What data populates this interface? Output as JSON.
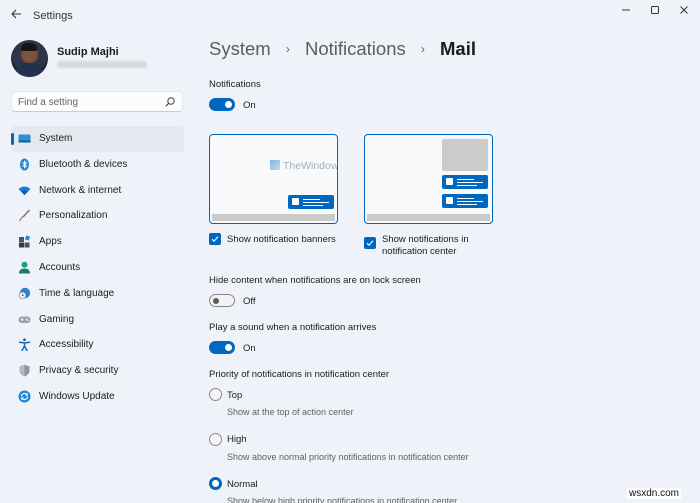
{
  "window": {
    "title": "Settings",
    "back_icon": "back-arrow-icon",
    "controls": {
      "minimize": "—",
      "maximize": "☐",
      "close": "✕"
    }
  },
  "profile": {
    "name": "Sudip Majhi",
    "email_blurred": true
  },
  "search": {
    "placeholder": "Find a setting",
    "value": "",
    "icon": "search-icon"
  },
  "sidebar": {
    "items": [
      {
        "label": "System",
        "icon": "system-icon",
        "active": true
      },
      {
        "label": "Bluetooth & devices",
        "icon": "bluetooth-icon",
        "active": false
      },
      {
        "label": "Network & internet",
        "icon": "wifi-icon",
        "active": false
      },
      {
        "label": "Personalization",
        "icon": "brush-icon",
        "active": false
      },
      {
        "label": "Apps",
        "icon": "apps-icon",
        "active": false
      },
      {
        "label": "Accounts",
        "icon": "person-icon",
        "active": false
      },
      {
        "label": "Time & language",
        "icon": "globe-clock-icon",
        "active": false
      },
      {
        "label": "Gaming",
        "icon": "gamepad-icon",
        "active": false
      },
      {
        "label": "Accessibility",
        "icon": "accessibility-icon",
        "active": false
      },
      {
        "label": "Privacy & security",
        "icon": "shield-icon",
        "active": false
      },
      {
        "label": "Windows Update",
        "icon": "update-icon",
        "active": false
      }
    ]
  },
  "breadcrumb": {
    "parts": [
      "System",
      "Notifications"
    ],
    "separator": "›",
    "current": "Mail"
  },
  "main": {
    "notifications": {
      "label": "Notifications",
      "state": "On",
      "on": true
    },
    "previews": {
      "watermark": "TheWindowsClub",
      "banners": {
        "label": "Show notification banners",
        "checked": true
      },
      "center": {
        "label": "Show notifications in notification center",
        "checked": true
      }
    },
    "hide_content": {
      "label": "Hide content when notifications are on lock screen",
      "state": "Off",
      "on": false
    },
    "play_sound": {
      "label": "Play a sound when a notification arrives",
      "state": "On",
      "on": true
    },
    "priority": {
      "label": "Priority of notifications in notification center",
      "options": [
        {
          "label": "Top",
          "description": "Show at the top of action center",
          "selected": false
        },
        {
          "label": "High",
          "description": "Show above normal priority notifications in notification center",
          "selected": false
        },
        {
          "label": "Normal",
          "description": "Show below high priority notifications in notification center",
          "selected": true
        }
      ]
    }
  },
  "watermark_site": "wsxdn.com",
  "colors": {
    "accent": "#0067c0",
    "background": "#eff3f9",
    "toggle_off_knob": "#5d5d5d"
  }
}
